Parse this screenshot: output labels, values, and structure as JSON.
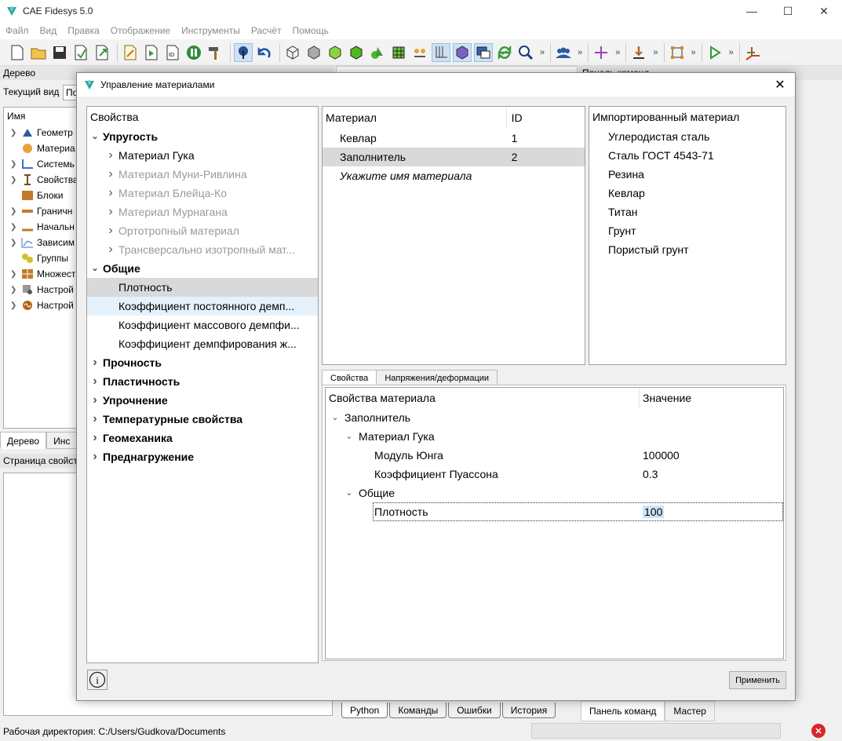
{
  "app": {
    "title": "CAE Fidesys 5.0",
    "menu": [
      "Файл",
      "Вид",
      "Правка",
      "Отображение",
      "Инструменты",
      "Расчёт",
      "Помощь"
    ],
    "more_glyph": "»",
    "window_buttons": [
      "—",
      "☐",
      "✕"
    ]
  },
  "left_dock": {
    "title": "Дерево",
    "current_view_label": "Текущий вид",
    "current_view_value": "По",
    "column_header": "Имя",
    "items": [
      {
        "label": "Геометр"
      },
      {
        "label": "Материа"
      },
      {
        "label": "Системь"
      },
      {
        "label": "Свойства"
      },
      {
        "label": "Блоки"
      },
      {
        "label": "Граничн"
      },
      {
        "label": "Начальн"
      },
      {
        "label": "Зависим"
      },
      {
        "label": "Группы"
      },
      {
        "label": "Множест"
      },
      {
        "label": "Настрой"
      },
      {
        "label": "Настрой"
      }
    ],
    "tabs": [
      "Дерево",
      "Инс"
    ],
    "props_title": "Страница свойст"
  },
  "right_dock": {
    "title": "Панель команд"
  },
  "bottom_tabs": [
    "Python",
    "Команды",
    "Ошибки",
    "История"
  ],
  "right_bottom_tabs": [
    "Панель команд",
    "Мастер"
  ],
  "status": {
    "workdir": "Рабочая директория: C:/Users/Gudkova/Documents",
    "error_glyph": "✕"
  },
  "dialog": {
    "title": "Управление материалами",
    "properties_header": "Свойства",
    "properties": [
      {
        "label": "Упругость",
        "level": 0,
        "state": "expanded",
        "style": "bold"
      },
      {
        "label": "Материал Гука",
        "level": 1,
        "state": "collapsed",
        "style": "normal"
      },
      {
        "label": "Материал Муни-Ривлина",
        "level": 1,
        "state": "collapsed",
        "style": "grey"
      },
      {
        "label": "Материал Блейца-Ко",
        "level": 1,
        "state": "collapsed",
        "style": "grey"
      },
      {
        "label": "Материал Мурнагана",
        "level": 1,
        "state": "collapsed",
        "style": "grey"
      },
      {
        "label": "Ортотропный материал",
        "level": 1,
        "state": "collapsed",
        "style": "grey"
      },
      {
        "label": "Трансверсально изотропный мат...",
        "level": 1,
        "state": "collapsed",
        "style": "grey"
      },
      {
        "label": "Общие",
        "level": 0,
        "state": "expanded",
        "style": "bold"
      },
      {
        "label": "Плотность",
        "level": 1,
        "state": "leaf",
        "style": "selected"
      },
      {
        "label": "Коэффициент постоянного демп...",
        "level": 1,
        "state": "leaf",
        "style": "hover"
      },
      {
        "label": "Коэффициент массового демпфи...",
        "level": 1,
        "state": "leaf",
        "style": "normal"
      },
      {
        "label": "Коэффициент демпфирования ж...",
        "level": 1,
        "state": "leaf",
        "style": "normal"
      },
      {
        "label": "Прочность",
        "level": 0,
        "state": "collapsed",
        "style": "bold"
      },
      {
        "label": "Пластичность",
        "level": 0,
        "state": "collapsed",
        "style": "bold"
      },
      {
        "label": "Упрочнение",
        "level": 0,
        "state": "collapsed",
        "style": "bold"
      },
      {
        "label": "Температурные свойства",
        "level": 0,
        "state": "collapsed",
        "style": "bold"
      },
      {
        "label": "Геомеханика",
        "level": 0,
        "state": "collapsed",
        "style": "bold"
      },
      {
        "label": "Преднагружение",
        "level": 0,
        "state": "collapsed",
        "style": "bold"
      }
    ],
    "materials": {
      "col_material": "Материал",
      "col_id": "ID",
      "rows": [
        {
          "name": "Кевлар",
          "id": "1"
        },
        {
          "name": "Заполнитель",
          "id": "2"
        }
      ],
      "placeholder": "Укажите имя материала"
    },
    "imported": {
      "header": "Импортированный материал",
      "items": [
        "Углеродистая сталь",
        "Сталь ГОСТ 4543-71",
        "Резина",
        "Кевлар",
        "Титан",
        "Грунт",
        "Пористый грунт"
      ]
    },
    "tabs": [
      "Свойства",
      "Напряжения/деформации"
    ],
    "values": {
      "col_property": "Свойства материала",
      "col_value": "Значение",
      "root": "Заполнитель",
      "group_hooke": "Материал Гука",
      "youngs_label": "Модуль Юнга",
      "youngs_value": "100000",
      "poisson_label": "Коэффициент Пуассона",
      "poisson_value": "0.3",
      "group_general": "Общие",
      "density_label": "Плотность",
      "density_value": "100"
    },
    "info_glyph": "i",
    "apply_label": "Применить",
    "close_glyph": "✕"
  }
}
